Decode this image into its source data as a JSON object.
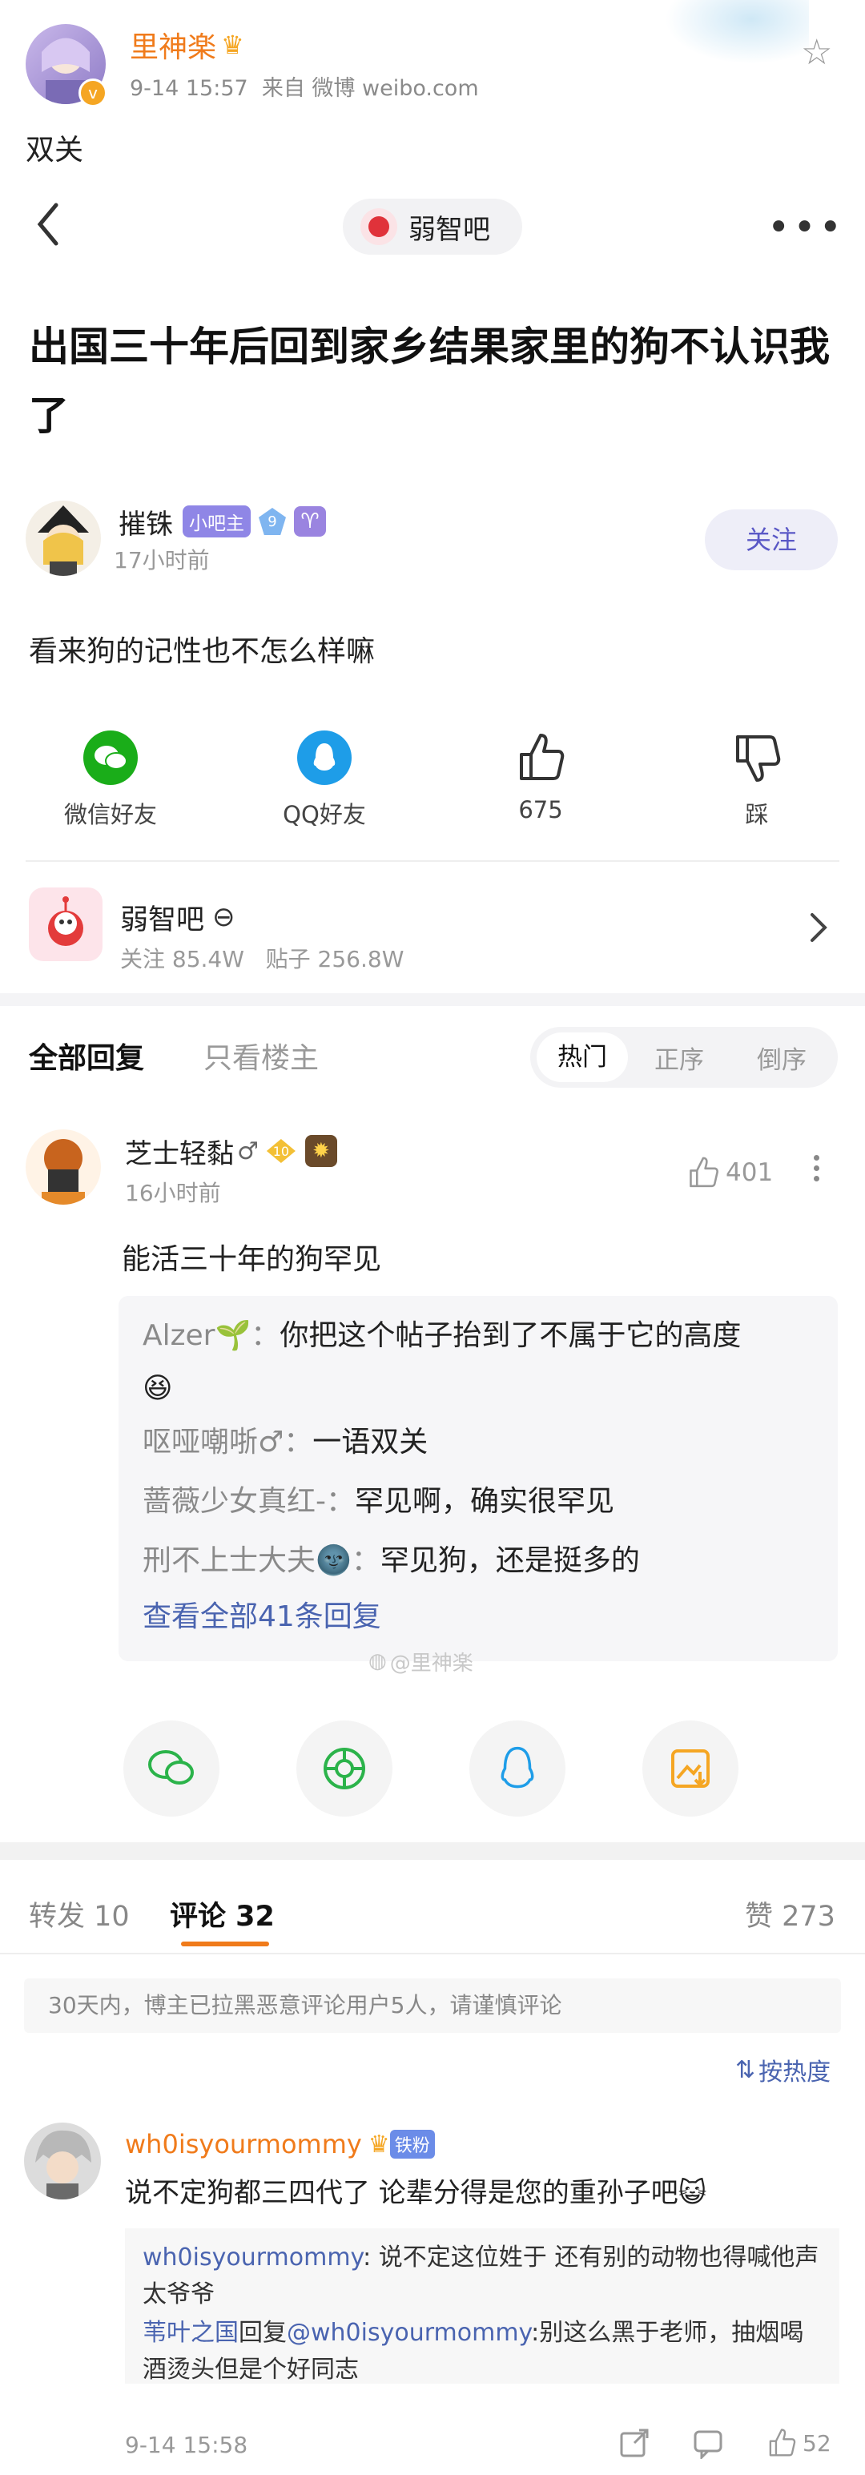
{
  "weibo_post": {
    "author": "里神楽",
    "meta": "9-14 15:57  来自 微博 weibo.com",
    "text": "双关"
  },
  "tieba_header": {
    "forum_name": "弱智吧"
  },
  "thread": {
    "title": "出国三十年后回到家乡结果家里的狗不认识我了",
    "poster_name": "摧铢",
    "poster_badge": "小吧主",
    "poster_level": "9",
    "poster_time": "17小时前",
    "follow_label": "关注",
    "body": "看来狗的记性也不怎么样嘛"
  },
  "share_actions": {
    "wechat": "微信好友",
    "qq": "QQ好友",
    "like_count": "675",
    "dislike": "踩"
  },
  "forum_card": {
    "name": "弱智吧",
    "stats": "关注 85.4W   贴子 256.8W"
  },
  "reply_tabs": {
    "all": "全部回复",
    "op_only": "只看楼主",
    "sort_hot": "热门",
    "sort_asc": "正序",
    "sort_desc": "倒序"
  },
  "top_reply": {
    "name": "芝士轻黏",
    "gender": "♂",
    "level": "10",
    "time": "16小时前",
    "like_count": "401",
    "text": "能活三十年的狗罕见",
    "sub_replies": [
      {
        "name": "Alzer🌱：",
        "text": "你把这个帖子抬到了不属于它的高度"
      },
      {
        "name": "",
        "text": "😆"
      },
      {
        "name": "呕哑嘲哳♂：",
        "text": "一语双关"
      },
      {
        "name": "蔷薇少女真红-：",
        "text": "罕见啊，确实很罕见"
      },
      {
        "name": "刑不上士大夫🌚：",
        "text": "罕见狗，还是挺多的"
      }
    ],
    "view_all": "查看全部41条回复"
  },
  "watermark": "@里神楽",
  "weibo_tabs": {
    "repost": "转发 10",
    "comment": "评论 32",
    "likes": "赞 273"
  },
  "notice": "30天内，博主已拉黑恶意评论用户5人，请谨慎评论",
  "sort_by_heat": "按热度",
  "comment": {
    "user": "wh0isyourmommy",
    "fan_badge": "铁粉",
    "text": "说不定狗都三四代了 论辈分得是您的重孙子吧😺",
    "replies": [
      {
        "name": "wh0isyourmommy",
        "text": ": 说不定这位姓于 还有别的动物也得喊他声太爷爷"
      },
      {
        "name": "苇叶之国",
        "mid": "回复",
        "target": "@wh0isyourmommy",
        "text": ":别这么黑于老师，抽烟喝酒烫头但是个好同志"
      }
    ],
    "time": "9-14 15:58",
    "like_count": "52"
  }
}
